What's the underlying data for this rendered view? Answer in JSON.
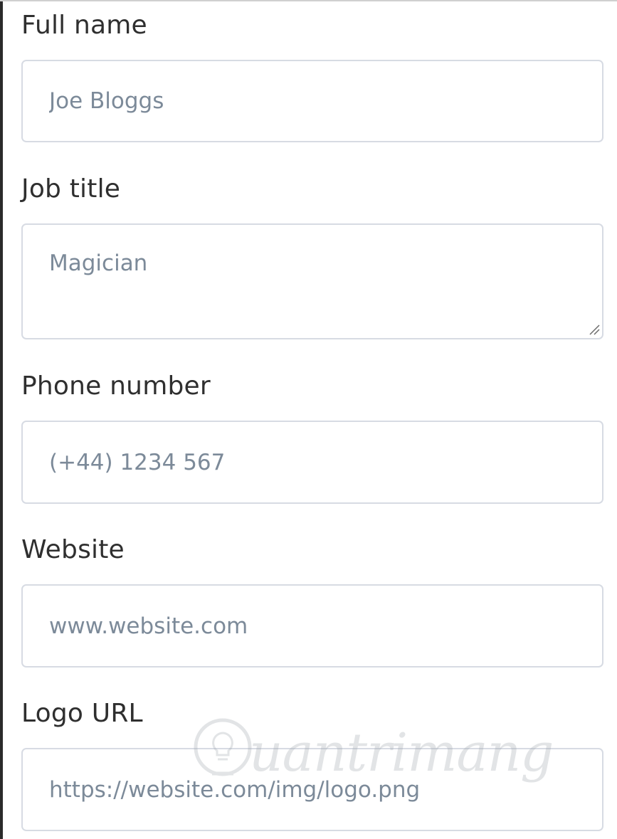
{
  "form": {
    "full_name": {
      "label": "Full name",
      "placeholder": "Joe Bloggs"
    },
    "job_title": {
      "label": "Job title",
      "placeholder": "Magician"
    },
    "phone_number": {
      "label": "Phone number",
      "placeholder": "(+44) 1234 567"
    },
    "website": {
      "label": "Website",
      "placeholder": "www.website.com"
    },
    "logo_url": {
      "label": "Logo URL",
      "placeholder": "https://website.com/img/logo.png"
    }
  },
  "watermark": {
    "text": "uantrimang",
    "icon": "lightbulb-icon"
  },
  "colors": {
    "label": "#2f2f2f",
    "placeholder": "#7c8a99",
    "border": "#d7dbe3"
  }
}
